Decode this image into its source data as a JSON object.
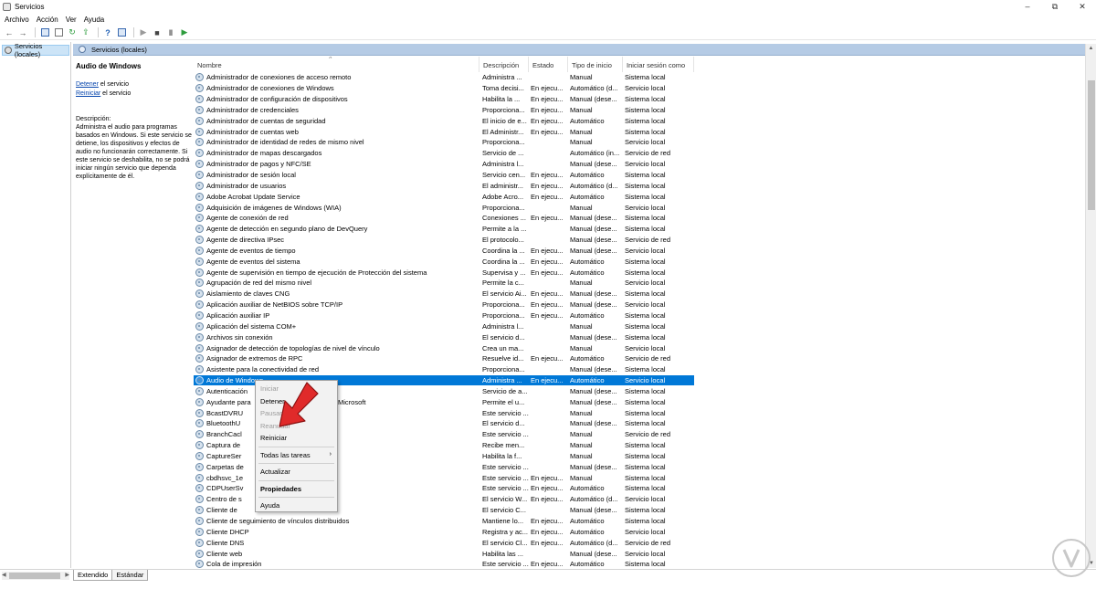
{
  "window": {
    "title": "Servicios",
    "minimize_icon": "minimize-icon",
    "restore_icon": "restore-icon",
    "close_icon": "close-icon"
  },
  "menu": [
    "Archivo",
    "Acción",
    "Ver",
    "Ayuda"
  ],
  "toolbar_icons": [
    "back-icon",
    "forward-icon",
    "console-tree-icon",
    "properties-icon",
    "refresh-icon",
    "export-icon",
    "help-icon",
    "view-icon",
    "play-icon",
    "stop-icon",
    "pause-icon",
    "restart-icon"
  ],
  "tree": {
    "item": "Servicios (locales)"
  },
  "panel_header": "Servicios (locales)",
  "description_pane": {
    "service_title": "Audio de Windows",
    "stop_link": "Detener",
    "stop_suffix": " el servicio",
    "restart_link": "Reiniciar",
    "restart_suffix": " el servicio",
    "label": "Descripción:",
    "text": "Administra el audio para programas basados en Windows. Si este servicio se detiene, los dispositivos y efectos de audio no funcionarán correctamente. Si este servicio se deshabilita, no se podrá iniciar ningún servicio que dependa explícitamente de él."
  },
  "columns": {
    "name": "Nombre",
    "description": "Descripción",
    "state": "Estado",
    "startup": "Tipo de inicio",
    "logon": "Iniciar sesión como"
  },
  "services": [
    {
      "name": "Administrador de conexiones de acceso remoto",
      "desc": "Administra ...",
      "state": "",
      "type": "Manual",
      "logon": "Sistema local"
    },
    {
      "name": "Administrador de conexiones de Windows",
      "desc": "Toma decisi...",
      "state": "En ejecu...",
      "type": "Automático (d...",
      "logon": "Servicio local"
    },
    {
      "name": "Administrador de configuración de dispositivos",
      "desc": "Habilita la ...",
      "state": "En ejecu...",
      "type": "Manual (dese...",
      "logon": "Sistema local"
    },
    {
      "name": "Administrador de credenciales",
      "desc": "Proporciona...",
      "state": "En ejecu...",
      "type": "Manual",
      "logon": "Sistema local"
    },
    {
      "name": "Administrador de cuentas de seguridad",
      "desc": "El inicio de e...",
      "state": "En ejecu...",
      "type": "Automático",
      "logon": "Sistema local"
    },
    {
      "name": "Administrador de cuentas web",
      "desc": "El Administr...",
      "state": "En ejecu...",
      "type": "Manual",
      "logon": "Sistema local"
    },
    {
      "name": "Administrador de identidad de redes de mismo nivel",
      "desc": "Proporciona...",
      "state": "",
      "type": "Manual",
      "logon": "Servicio local"
    },
    {
      "name": "Administrador de mapas descargados",
      "desc": "Servicio de ...",
      "state": "",
      "type": "Automático (in...",
      "logon": "Servicio de red"
    },
    {
      "name": "Administrador de pagos y NFC/SE",
      "desc": "Administra l...",
      "state": "",
      "type": "Manual (dese...",
      "logon": "Servicio local"
    },
    {
      "name": "Administrador de sesión local",
      "desc": "Servicio cen...",
      "state": "En ejecu...",
      "type": "Automático",
      "logon": "Sistema local"
    },
    {
      "name": "Administrador de usuarios",
      "desc": "El administr...",
      "state": "En ejecu...",
      "type": "Automático (d...",
      "logon": "Sistema local"
    },
    {
      "name": "Adobe Acrobat Update Service",
      "desc": "Adobe Acro...",
      "state": "En ejecu...",
      "type": "Automático",
      "logon": "Sistema local"
    },
    {
      "name": "Adquisición de imágenes de Windows (WIA)",
      "desc": "Proporciona...",
      "state": "",
      "type": "Manual",
      "logon": "Servicio local"
    },
    {
      "name": "Agente de conexión de red",
      "desc": "Conexiones ...",
      "state": "En ejecu...",
      "type": "Manual (dese...",
      "logon": "Sistema local"
    },
    {
      "name": "Agente de detección en segundo plano de DevQuery",
      "desc": "Permite a la ...",
      "state": "",
      "type": "Manual (dese...",
      "logon": "Sistema local"
    },
    {
      "name": "Agente de directiva IPsec",
      "desc": "El protocolo...",
      "state": "",
      "type": "Manual (dese...",
      "logon": "Servicio de red"
    },
    {
      "name": "Agente de eventos de tiempo",
      "desc": "Coordina la ...",
      "state": "En ejecu...",
      "type": "Manual (dese...",
      "logon": "Servicio local"
    },
    {
      "name": "Agente de eventos del sistema",
      "desc": "Coordina la ...",
      "state": "En ejecu...",
      "type": "Automático",
      "logon": "Sistema local"
    },
    {
      "name": "Agente de supervisión en tiempo de ejecución de Protección del sistema",
      "desc": "Supervisa y ...",
      "state": "En ejecu...",
      "type": "Automático",
      "logon": "Sistema local"
    },
    {
      "name": "Agrupación de red del mismo nivel",
      "desc": "Permite la c...",
      "state": "",
      "type": "Manual",
      "logon": "Servicio local"
    },
    {
      "name": "Aislamiento de claves CNG",
      "desc": "El servicio Ai...",
      "state": "En ejecu...",
      "type": "Manual (dese...",
      "logon": "Sistema local"
    },
    {
      "name": "Aplicación auxiliar de NetBIOS sobre TCP/IP",
      "desc": "Proporciona...",
      "state": "En ejecu...",
      "type": "Manual (dese...",
      "logon": "Servicio local"
    },
    {
      "name": "Aplicación auxiliar IP",
      "desc": "Proporciona...",
      "state": "En ejecu...",
      "type": "Automático",
      "logon": "Sistema local"
    },
    {
      "name": "Aplicación del sistema COM+",
      "desc": "Administra l...",
      "state": "",
      "type": "Manual",
      "logon": "Sistema local"
    },
    {
      "name": "Archivos sin conexión",
      "desc": "El servicio d...",
      "state": "",
      "type": "Manual (dese...",
      "logon": "Sistema local"
    },
    {
      "name": "Asignador de detección de topologías de nivel de vínculo",
      "desc": "Crea un ma...",
      "state": "",
      "type": "Manual",
      "logon": "Servicio local"
    },
    {
      "name": "Asignador de extremos de RPC",
      "desc": "Resuelve id...",
      "state": "En ejecu...",
      "type": "Automático",
      "logon": "Servicio de red"
    },
    {
      "name": "Asistente para la conectividad de red",
      "desc": "Proporciona...",
      "state": "",
      "type": "Manual (dese...",
      "logon": "Sistema local"
    },
    {
      "name": "Audio de Windows",
      "desc": "Administra ...",
      "state": "En ejecu...",
      "type": "Automático",
      "logon": "Servicio local",
      "selected": true
    },
    {
      "name": "Autenticación",
      "desc": "Servicio de a...",
      "state": "",
      "type": "Manual (dese...",
      "logon": "Sistema local"
    },
    {
      "name": "Ayudante para",
      "name_tail": "Microsoft",
      "desc": "Permite el u...",
      "state": "",
      "type": "Manual (dese...",
      "logon": "Sistema local"
    },
    {
      "name": "BcastDVRU",
      "desc": "Este servicio ...",
      "state": "",
      "type": "Manual",
      "logon": "Sistema local"
    },
    {
      "name": "BluetoothU",
      "desc": "El servicio d...",
      "state": "",
      "type": "Manual (dese...",
      "logon": "Sistema local"
    },
    {
      "name": "BranchCacl",
      "desc": "Este servicio ...",
      "state": "",
      "type": "Manual",
      "logon": "Servicio de red"
    },
    {
      "name": "Captura de",
      "desc": "Recibe men...",
      "state": "",
      "type": "Manual",
      "logon": "Sistema local"
    },
    {
      "name": "CaptureSer",
      "desc": "Habilita la f...",
      "state": "",
      "type": "Manual",
      "logon": "Sistema local"
    },
    {
      "name": "Carpetas de",
      "desc": "Este servicio ...",
      "state": "",
      "type": "Manual (dese...",
      "logon": "Sistema local"
    },
    {
      "name": "cbdhsvc_1e",
      "desc": "Este servicio ...",
      "state": "En ejecu...",
      "type": "Manual",
      "logon": "Sistema local"
    },
    {
      "name": "CDPUserSv",
      "desc": "Este servicio ...",
      "state": "En ejecu...",
      "type": "Automático",
      "logon": "Sistema local"
    },
    {
      "name": "Centro de s",
      "desc": "El servicio W...",
      "state": "En ejecu...",
      "type": "Automático (d...",
      "logon": "Servicio local"
    },
    {
      "name": "Cliente de",
      "desc": "El servicio C...",
      "state": "",
      "type": "Manual (dese...",
      "logon": "Sistema local"
    },
    {
      "name": "Cliente de seguimiento de vínculos distribuidos",
      "desc": "Mantiene lo...",
      "state": "En ejecu...",
      "type": "Automático",
      "logon": "Sistema local"
    },
    {
      "name": "Cliente DHCP",
      "desc": "Registra y ac...",
      "state": "En ejecu...",
      "type": "Automático",
      "logon": "Servicio local"
    },
    {
      "name": "Cliente DNS",
      "desc": "El servicio Cl...",
      "state": "En ejecu...",
      "type": "Automático (d...",
      "logon": "Servicio de red"
    },
    {
      "name": "Cliente web",
      "desc": "Habilita las ...",
      "state": "",
      "type": "Manual (dese...",
      "logon": "Servicio local"
    },
    {
      "name": "Cola de impresión",
      "desc": "Este servicio ...",
      "state": "En ejecu...",
      "type": "Automático",
      "logon": "Sistema local"
    }
  ],
  "context_menu": {
    "start": "Iniciar",
    "stop": "Detener",
    "pause": "Pausar",
    "resume": "Reanudar",
    "restart": "Reiniciar",
    "all_tasks": "Todas las tareas",
    "refresh": "Actualizar",
    "properties": "Propiedades",
    "help": "Ayuda"
  },
  "tabs": [
    "Extendido",
    "Estándar"
  ],
  "colors": {
    "selection": "#0078d7",
    "pointer_arrow": "#e02a2a",
    "header_band": "#b5cbe5"
  }
}
